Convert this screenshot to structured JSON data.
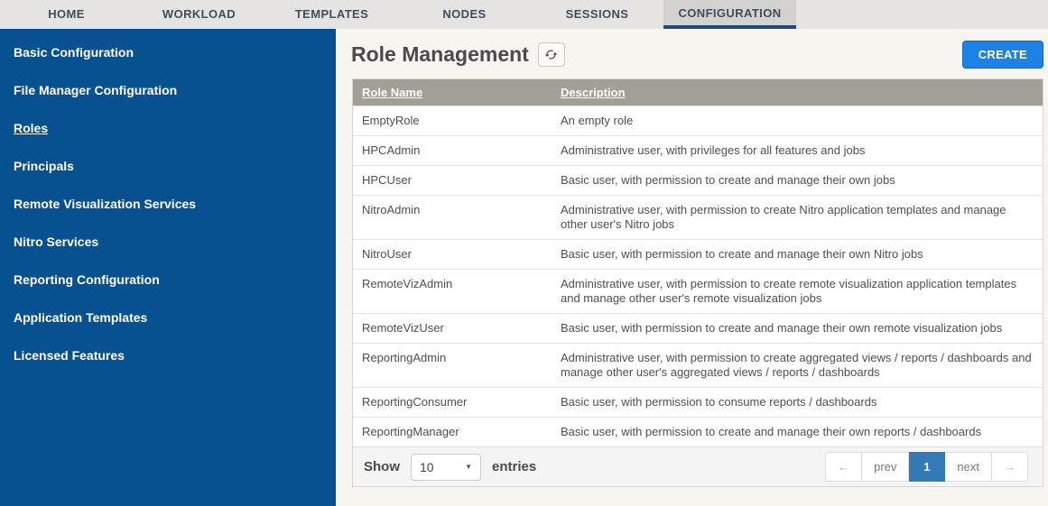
{
  "nav": {
    "items": [
      "HOME",
      "WORKLOAD",
      "TEMPLATES",
      "NODES",
      "SESSIONS",
      "CONFIGURATION"
    ],
    "active": "CONFIGURATION"
  },
  "sidebar": {
    "items": [
      "Basic Configuration",
      "File Manager Configuration",
      "Roles",
      "Principals",
      "Remote Visualization Services",
      "Nitro Services",
      "Reporting Configuration",
      "Application Templates",
      "Licensed Features"
    ],
    "active": "Roles"
  },
  "main": {
    "title": "Role Management",
    "create_button": "CREATE",
    "table": {
      "columns": [
        "Role Name",
        "Description"
      ],
      "rows": [
        {
          "role": "EmptyRole",
          "description": "An empty role"
        },
        {
          "role": "HPCAdmin",
          "description": "Administrative user, with privileges for all features and jobs"
        },
        {
          "role": "HPCUser",
          "description": "Basic user, with permission to create and manage their own jobs"
        },
        {
          "role": "NitroAdmin",
          "description": "Administrative user, with permission to create Nitro application templates and manage other user's Nitro jobs"
        },
        {
          "role": "NitroUser",
          "description": "Basic user, with permission to create and manage their own Nitro jobs"
        },
        {
          "role": "RemoteVizAdmin",
          "description": "Administrative user, with permission to create remote visualization application templates and manage other user's remote visualization jobs"
        },
        {
          "role": "RemoteVizUser",
          "description": "Basic user, with permission to create and manage their own remote visualization jobs"
        },
        {
          "role": "ReportingAdmin",
          "description": "Administrative user, with permission to create aggregated views / reports / dashboards and manage other user's aggregated views / reports / dashboards"
        },
        {
          "role": "ReportingConsumer",
          "description": "Basic user, with permission to consume reports / dashboards"
        },
        {
          "role": "ReportingManager",
          "description": "Basic user, with permission to create and manage their own reports / dashboards"
        }
      ]
    },
    "footer": {
      "show_label": "Show",
      "page_size": "10",
      "entries_label": "entries",
      "pager": {
        "first": "←",
        "prev": "prev",
        "page": "1",
        "next": "next",
        "last": "→",
        "active_page": "1"
      }
    }
  },
  "icons": {
    "refresh": "refresh-icon",
    "caret_down": "▼"
  },
  "colors": {
    "sidebar_blue": "#085190",
    "nav_bg": "#e5e4e2",
    "nav_active_bg": "#d3d2d0",
    "nav_active_underline": "#1c4b7b",
    "create_button_blue": "#1a83e5",
    "table_header_bg": "#a2a096",
    "pager_active_blue": "#337ab7",
    "main_bg": "#f7f5f0"
  }
}
